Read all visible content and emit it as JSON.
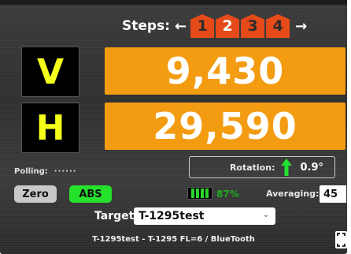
{
  "steps": {
    "label": "Steps:",
    "left_arrow": "←",
    "right_arrow": "→",
    "items": [
      "1",
      "2",
      "3",
      "4"
    ],
    "active_index": 1
  },
  "vertical": {
    "axis": "V",
    "value": "9,430"
  },
  "horizontal": {
    "axis": "H",
    "value": "29,590"
  },
  "polling": {
    "label": "Polling:",
    "indicator": "······"
  },
  "rotation": {
    "label": "Rotation:",
    "value": "0.9°",
    "direction_icon": "up-arrow-icon"
  },
  "controls": {
    "zero_label": "Zero",
    "abs_label": "ABS"
  },
  "battery": {
    "percent_text": "87%",
    "level": 0.87
  },
  "averaging": {
    "label": "Averaging:",
    "value": "45"
  },
  "target": {
    "label": "Target",
    "selected": "T-1295test"
  },
  "device_info": "T-1295test - T-1295 FL=6 / BlueTooth",
  "colors": {
    "value_bg": "#f39c12",
    "axis_text": "#f4ff1a",
    "step_active": "#e64a19",
    "abs_green": "#25e12b",
    "rotation_arrow": "#22e230"
  }
}
